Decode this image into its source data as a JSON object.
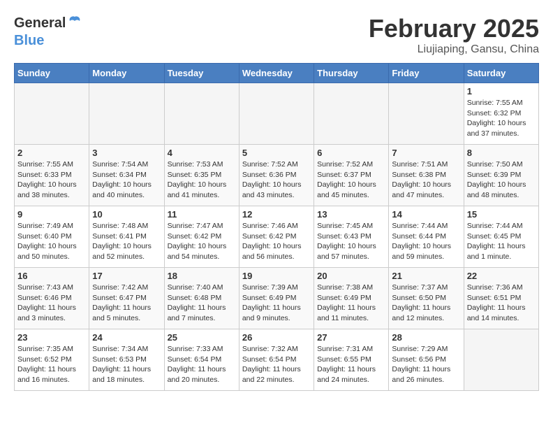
{
  "header": {
    "logo_general": "General",
    "logo_blue": "Blue",
    "title": "February 2025",
    "subtitle": "Liujiaping, Gansu, China"
  },
  "weekdays": [
    "Sunday",
    "Monday",
    "Tuesday",
    "Wednesday",
    "Thursday",
    "Friday",
    "Saturday"
  ],
  "weeks": [
    [
      {
        "day": "",
        "info": ""
      },
      {
        "day": "",
        "info": ""
      },
      {
        "day": "",
        "info": ""
      },
      {
        "day": "",
        "info": ""
      },
      {
        "day": "",
        "info": ""
      },
      {
        "day": "",
        "info": ""
      },
      {
        "day": "1",
        "info": "Sunrise: 7:55 AM\nSunset: 6:32 PM\nDaylight: 10 hours\nand 37 minutes."
      }
    ],
    [
      {
        "day": "2",
        "info": "Sunrise: 7:55 AM\nSunset: 6:33 PM\nDaylight: 10 hours\nand 38 minutes."
      },
      {
        "day": "3",
        "info": "Sunrise: 7:54 AM\nSunset: 6:34 PM\nDaylight: 10 hours\nand 40 minutes."
      },
      {
        "day": "4",
        "info": "Sunrise: 7:53 AM\nSunset: 6:35 PM\nDaylight: 10 hours\nand 41 minutes."
      },
      {
        "day": "5",
        "info": "Sunrise: 7:52 AM\nSunset: 6:36 PM\nDaylight: 10 hours\nand 43 minutes."
      },
      {
        "day": "6",
        "info": "Sunrise: 7:52 AM\nSunset: 6:37 PM\nDaylight: 10 hours\nand 45 minutes."
      },
      {
        "day": "7",
        "info": "Sunrise: 7:51 AM\nSunset: 6:38 PM\nDaylight: 10 hours\nand 47 minutes."
      },
      {
        "day": "8",
        "info": "Sunrise: 7:50 AM\nSunset: 6:39 PM\nDaylight: 10 hours\nand 48 minutes."
      }
    ],
    [
      {
        "day": "9",
        "info": "Sunrise: 7:49 AM\nSunset: 6:40 PM\nDaylight: 10 hours\nand 50 minutes."
      },
      {
        "day": "10",
        "info": "Sunrise: 7:48 AM\nSunset: 6:41 PM\nDaylight: 10 hours\nand 52 minutes."
      },
      {
        "day": "11",
        "info": "Sunrise: 7:47 AM\nSunset: 6:42 PM\nDaylight: 10 hours\nand 54 minutes."
      },
      {
        "day": "12",
        "info": "Sunrise: 7:46 AM\nSunset: 6:42 PM\nDaylight: 10 hours\nand 56 minutes."
      },
      {
        "day": "13",
        "info": "Sunrise: 7:45 AM\nSunset: 6:43 PM\nDaylight: 10 hours\nand 57 minutes."
      },
      {
        "day": "14",
        "info": "Sunrise: 7:44 AM\nSunset: 6:44 PM\nDaylight: 10 hours\nand 59 minutes."
      },
      {
        "day": "15",
        "info": "Sunrise: 7:44 AM\nSunset: 6:45 PM\nDaylight: 11 hours\nand 1 minute."
      }
    ],
    [
      {
        "day": "16",
        "info": "Sunrise: 7:43 AM\nSunset: 6:46 PM\nDaylight: 11 hours\nand 3 minutes."
      },
      {
        "day": "17",
        "info": "Sunrise: 7:42 AM\nSunset: 6:47 PM\nDaylight: 11 hours\nand 5 minutes."
      },
      {
        "day": "18",
        "info": "Sunrise: 7:40 AM\nSunset: 6:48 PM\nDaylight: 11 hours\nand 7 minutes."
      },
      {
        "day": "19",
        "info": "Sunrise: 7:39 AM\nSunset: 6:49 PM\nDaylight: 11 hours\nand 9 minutes."
      },
      {
        "day": "20",
        "info": "Sunrise: 7:38 AM\nSunset: 6:49 PM\nDaylight: 11 hours\nand 11 minutes."
      },
      {
        "day": "21",
        "info": "Sunrise: 7:37 AM\nSunset: 6:50 PM\nDaylight: 11 hours\nand 12 minutes."
      },
      {
        "day": "22",
        "info": "Sunrise: 7:36 AM\nSunset: 6:51 PM\nDaylight: 11 hours\nand 14 minutes."
      }
    ],
    [
      {
        "day": "23",
        "info": "Sunrise: 7:35 AM\nSunset: 6:52 PM\nDaylight: 11 hours\nand 16 minutes."
      },
      {
        "day": "24",
        "info": "Sunrise: 7:34 AM\nSunset: 6:53 PM\nDaylight: 11 hours\nand 18 minutes."
      },
      {
        "day": "25",
        "info": "Sunrise: 7:33 AM\nSunset: 6:54 PM\nDaylight: 11 hours\nand 20 minutes."
      },
      {
        "day": "26",
        "info": "Sunrise: 7:32 AM\nSunset: 6:54 PM\nDaylight: 11 hours\nand 22 minutes."
      },
      {
        "day": "27",
        "info": "Sunrise: 7:31 AM\nSunset: 6:55 PM\nDaylight: 11 hours\nand 24 minutes."
      },
      {
        "day": "28",
        "info": "Sunrise: 7:29 AM\nSunset: 6:56 PM\nDaylight: 11 hours\nand 26 minutes."
      },
      {
        "day": "",
        "info": ""
      }
    ]
  ]
}
